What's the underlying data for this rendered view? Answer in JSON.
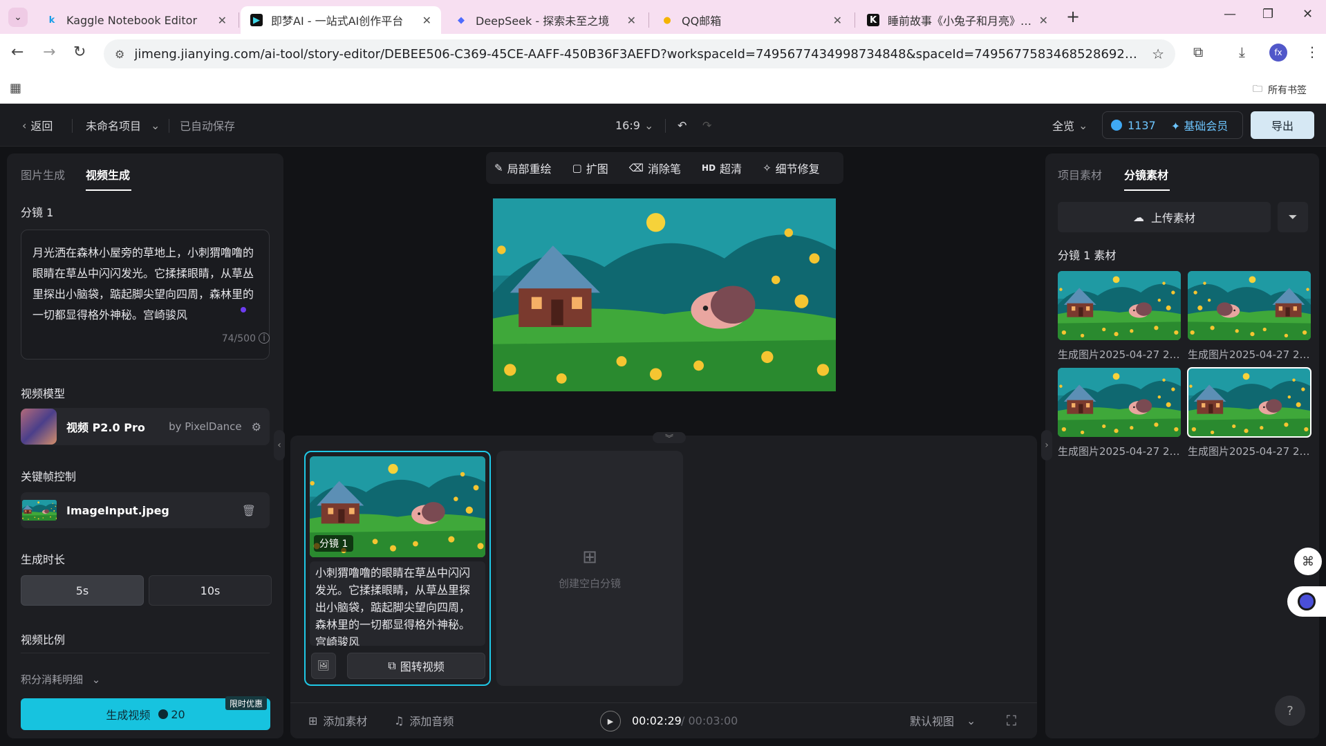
{
  "browser": {
    "tabs": [
      {
        "title": "Kaggle Notebook Editor",
        "favicon": "k",
        "favicon_color": "#1a9ee8"
      },
      {
        "title": "即梦AI - 一站式AI创作平台",
        "favicon": "▶",
        "favicon_color": "#111111"
      },
      {
        "title": "DeepSeek - 探索未至之境",
        "favicon": "◆",
        "favicon_color": "#4d6bfe"
      },
      {
        "title": "QQ邮箱",
        "favicon": "●",
        "favicon_color": "#f4b400"
      },
      {
        "title": "睡前故事《小兔子和月亮》分镜",
        "favicon": "K",
        "favicon_color": "#111111"
      }
    ],
    "url": "jimeng.jianying.com/ai-tool/story-editor/DEBEE506-C369-45CE-AAFF-450B36F3AEFD?workspaceId=7495677434998734848&spaceId=7495677583468528692&storyId=42...",
    "profile_initials": "fx",
    "bookmarks_label": "所有书签"
  },
  "header": {
    "back_label": "返回",
    "project_name": "未命名项目",
    "autosave": "已自动保存",
    "aspect_ratio": "16:9",
    "view_mode": "全览",
    "credits": "1137",
    "membership": "基础会员",
    "export_label": "导出"
  },
  "left_panel": {
    "tabs": [
      "图片生成",
      "视频生成"
    ],
    "shot_title": "分镜 1",
    "prompt": "月光洒在森林小屋旁的草地上，小刺猬噜噜的眼睛在草丛中闪闪发光。它揉揉眼睛，从草丛里探出小脑袋，踮起脚尖望向四周，森林里的一切都显得格外神秘。宫崎骏风",
    "prompt_count": "74/500",
    "model_section": "视频模型",
    "model_name": "视频 P2.0 Pro",
    "model_by": "by PixelDance",
    "keyframe_section": "关键帧控制",
    "keyframe_file": "ImageInput.jpeg",
    "duration_section": "生成时长",
    "durations": [
      "5s",
      "10s"
    ],
    "ratio_section": "视频比例",
    "credit_detail": "积分消耗明细",
    "generate_label": "生成视频",
    "generate_cost": "20",
    "promo_badge": "限时优惠"
  },
  "edit_toolbar": [
    "局部重绘",
    "扩图",
    "消除笔",
    "超清",
    "细节修复"
  ],
  "hd_badge": "HD",
  "timeline": {
    "shot_tag": "分镜 1",
    "shot_desc": "小刺猬噜噜的眼睛在草丛中闪闪发光。它揉揉眼睛，从草丛里探出小脑袋，踮起脚尖望向四周，森林里的一切都显得格外神秘。宫崎骏风",
    "img2video_label": "图转视频",
    "empty_shot_label": "创建空白分镜",
    "add_asset": "添加素材",
    "add_audio": "添加音频",
    "time_current": "00:02:29",
    "time_total": "/ 00:03:00",
    "default_view": "默认视图"
  },
  "right_panel": {
    "tabs": [
      "项目素材",
      "分镜素材"
    ],
    "upload_label": "上传素材",
    "assets_title": "分镜 1 素材",
    "assets": [
      {
        "label": "生成图片2025-04-27 20..."
      },
      {
        "label": "生成图片2025-04-27 20..."
      },
      {
        "label": "生成图片2025-04-27 20..."
      },
      {
        "label": "生成图片2025-04-27 20..."
      }
    ]
  },
  "colors": {
    "accent": "#17c3df",
    "credit_blue": "#6ec6ff",
    "export_bg": "#d6e8f4"
  }
}
